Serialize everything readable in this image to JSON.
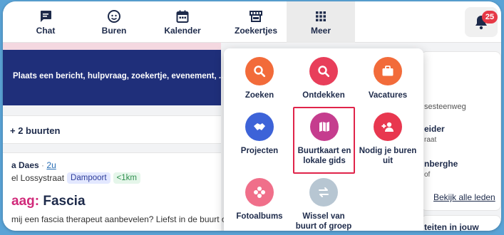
{
  "nav": {
    "items": [
      {
        "label": "Chat",
        "icon": "chat-icon"
      },
      {
        "label": "Buren",
        "icon": "neighbours-icon"
      },
      {
        "label": "Kalender",
        "icon": "calendar-icon"
      },
      {
        "label": "Zoekertjes",
        "icon": "store-icon"
      },
      {
        "label": "Meer",
        "icon": "grid-icon"
      }
    ],
    "notifications": "25"
  },
  "feed": {
    "compose_prompt": "Plaats een bericht, hulpvraag, zoekertje, evenement, ...",
    "neighbourhoods": "+ 2 buurten",
    "post": {
      "author": "a Daes",
      "separator": "·",
      "time": "2u",
      "street": "el Lossystraat",
      "neighbourhood": "Dampoort",
      "distance": "<1km",
      "title_prefix": "aag:",
      "title": "Fascia",
      "body": "mij een fascia therapeut aanbevelen? Liefst in de buurt of"
    }
  },
  "sidebar": {
    "address_fragment": "sesteenweg",
    "member1_name": "eider",
    "member1_sub": "raat",
    "member2_name": "nberghe",
    "member2_sub": "of",
    "all_members_link": "Bekijk alle leden",
    "activities_fragment": "teiten in jouw"
  },
  "menu": {
    "items": [
      {
        "label": "Zoeken",
        "color": "#f26b3a",
        "icon": "search-icon"
      },
      {
        "label": "Ontdekken",
        "color": "#e83e5a",
        "icon": "search-icon"
      },
      {
        "label": "Vacatures",
        "color": "#f26b3a",
        "icon": "briefcase-icon"
      },
      {
        "label": "Projecten",
        "color": "#3d63d8",
        "icon": "handshake-icon"
      },
      {
        "label": "Buurtkaart en lokale gids",
        "color": "#c53d8e",
        "icon": "map-icon"
      },
      {
        "label": "Nodig je buren uit",
        "color": "#e8374f",
        "icon": "add-person-icon"
      },
      {
        "label": "Fotoalbums",
        "color": "#f06f8a",
        "icon": "flower-icon"
      },
      {
        "label": "Wissel van buurt of groep",
        "color": "#b7c6d2",
        "icon": "swap-icon"
      }
    ]
  }
}
